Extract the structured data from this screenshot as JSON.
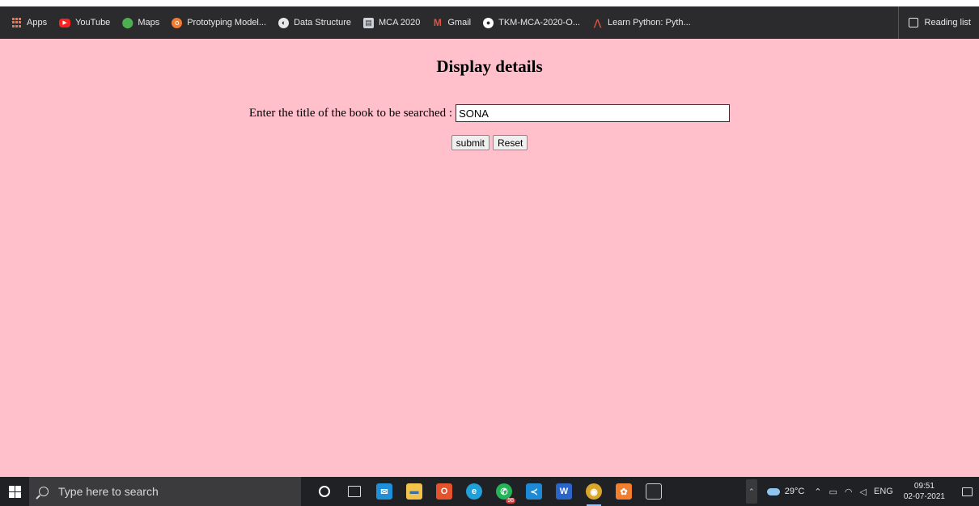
{
  "bookmarks": [
    {
      "label": "Apps",
      "icon": "apps-grid-icon"
    },
    {
      "label": "YouTube",
      "icon": "youtube-icon"
    },
    {
      "label": "Maps",
      "icon": "maps-pin-icon"
    },
    {
      "label": "Prototyping Model...",
      "icon": "prototyping-icon"
    },
    {
      "label": "Data Structure",
      "icon": "globe-icon"
    },
    {
      "label": "MCA 2020",
      "icon": "mca-icon"
    },
    {
      "label": "Gmail",
      "icon": "gmail-icon"
    },
    {
      "label": "TKM-MCA-2020-O...",
      "icon": "github-icon"
    },
    {
      "label": "Learn Python: Pyth...",
      "icon": "learn-python-icon"
    }
  ],
  "reading_list": "Reading list",
  "page": {
    "title": "Display details",
    "label": "Enter the title of the book to be searched :",
    "input_value": "SONA",
    "submit_label": "submit",
    "reset_label": "Reset",
    "background": "#ffc0cb"
  },
  "taskbar": {
    "search_placeholder": "Type here to search",
    "badge": "98",
    "weather": "29°C",
    "language": "ENG",
    "time": "09:51",
    "date": "02-07-2021"
  }
}
